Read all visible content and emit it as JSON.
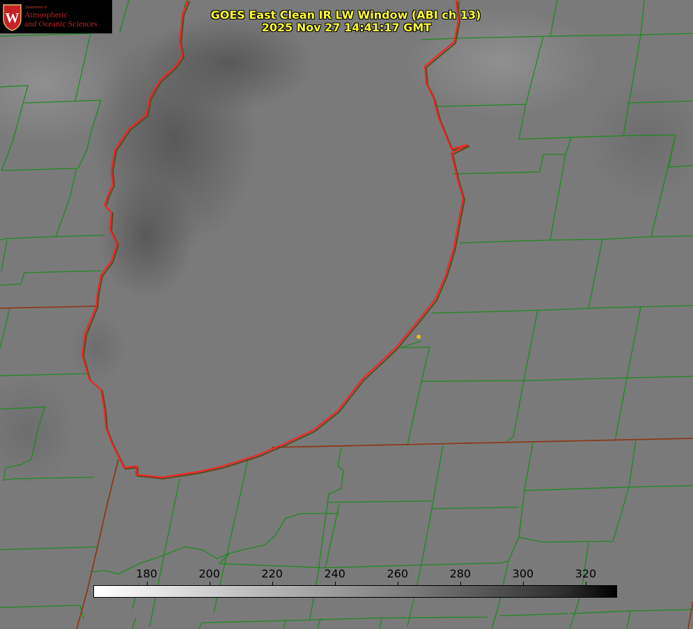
{
  "title": {
    "line1": "GOES East Clean IR LW Window (ABI ch 13)",
    "line2": "2025 Nov 27 14:41:17 GMT"
  },
  "logo": {
    "dept": "Department of",
    "line1": "Atmospheric",
    "line2": "and Oceanic Sciences",
    "seal_letter": "W"
  },
  "colorbar": {
    "ticks": [
      "180",
      "200",
      "220",
      "240",
      "260",
      "280",
      "300",
      "320"
    ],
    "tick_values": [
      180,
      200,
      220,
      240,
      260,
      280,
      300,
      320
    ],
    "range": [
      163,
      330
    ],
    "colormap": "white-to-black grayscale"
  },
  "colors": {
    "county_lines": "#1f8a1f",
    "state_lines": "#8b3a1a",
    "coastline": "#ff2020",
    "marker": "#e0c020",
    "title_text": "#ffff33"
  }
}
